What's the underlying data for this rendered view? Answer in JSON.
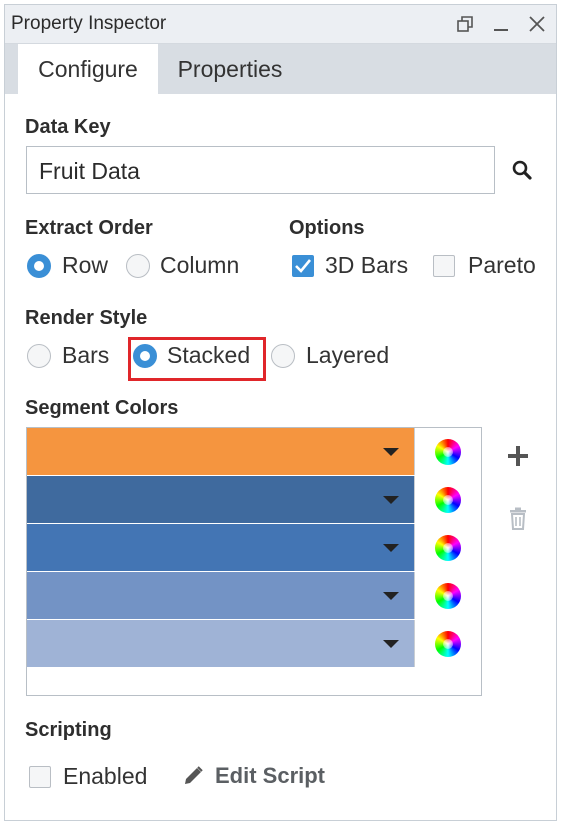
{
  "window": {
    "title": "Property Inspector"
  },
  "tabs": [
    {
      "label": "Configure",
      "active": true
    },
    {
      "label": "Properties",
      "active": false
    }
  ],
  "data_key": {
    "label": "Data Key",
    "value": "Fruit Data"
  },
  "extract_order": {
    "label": "Extract Order",
    "options": [
      {
        "label": "Row",
        "selected": true
      },
      {
        "label": "Column",
        "selected": false
      }
    ]
  },
  "options": {
    "label": "Options",
    "items": [
      {
        "label": "3D Bars",
        "checked": true
      },
      {
        "label": "Pareto",
        "checked": false
      }
    ]
  },
  "render_style": {
    "label": "Render Style",
    "options": [
      {
        "label": "Bars",
        "selected": false
      },
      {
        "label": "Stacked",
        "selected": true
      },
      {
        "label": "Layered",
        "selected": false
      }
    ]
  },
  "segment_colors": {
    "label": "Segment Colors",
    "colors": [
      "#f5953f",
      "#3f6a9e",
      "#4375b4",
      "#7393c5",
      "#9fb3d6"
    ]
  },
  "scripting": {
    "label": "Scripting",
    "enabled": {
      "label": "Enabled",
      "checked": false
    },
    "edit_script": "Edit Script"
  },
  "colors": {
    "accent": "#3a8fd6",
    "highlight": "#e0262a"
  }
}
